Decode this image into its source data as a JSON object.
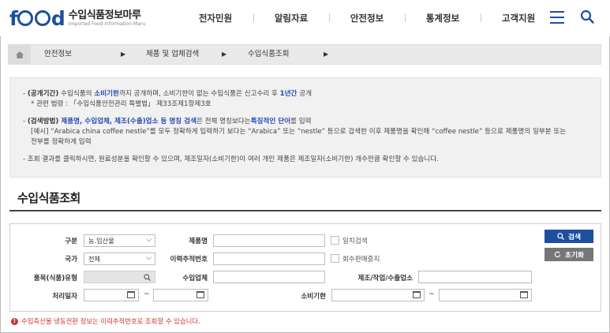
{
  "header": {
    "logo_title": "수입식품정보마루",
    "logo_sub": "Imported Food Information Maru",
    "nav": [
      "전자민원",
      "알림자료",
      "안전정보",
      "통계정보",
      "고객지원"
    ]
  },
  "breadcrumb": [
    "안전정보",
    "제품 및 업체검색",
    "수입식품조회"
  ],
  "notice": {
    "l1_a": "- ",
    "l1_b": "(공개기간)",
    "l1_c": " 수입식품의 ",
    "l1_d": "소비기한",
    "l1_e": "까지 공개하며, 소비기한이 없는 수입식품은 신고수리 후 ",
    "l1_f": "1년간",
    "l1_g": " 공개",
    "l2": "* 관련 법령 : 「수입식품안전관리 특별법」 제33조제1항제3호",
    "l3_a": "- ",
    "l3_b": "(검색방법)",
    "l3_c": " 제품명, 수입업체, 제조(수출)업소 등 명칭 검색",
    "l3_d": "은 전체 명칭보다는",
    "l3_e": "특징적인 단어",
    "l3_f": "를 입력",
    "l4": "[예시] “Arabica china coffee nestle”를 모두 정확하게 입력하기 보다는 “Arabica” 또는 “nestle” 등으로 검색한 이후 제품명을 확인해 “coffee nestle” 등으로 제품명의 일부분 또는",
    "l5": "전부를 정확하게 입력",
    "l6": "- 조회 결과를 클릭하시면, 원료성분을 확인할 수 있으며, 제조일자(소비기한)이 여러 개인 제품은 제조일자(소비기한) 개수만큼 확인할 수 있습니다."
  },
  "page_title": "수입식품조회",
  "form": {
    "category_label": "구분",
    "category_value": "농.임산물",
    "country_label": "국가",
    "country_value": "전체",
    "type_label": "품목(식품)유형",
    "date_label": "처리일자",
    "product_label": "제품명",
    "trace_label": "이력추적번호",
    "importer_label": "수입업체",
    "expiry_label": "소비기한",
    "exact_label": "일치검색",
    "recall_label": "회수판매중지",
    "maker_label": "제조/작업/수출업소",
    "tilde": "~",
    "search_button": "검색",
    "reset_button": "초기화"
  },
  "warning": "수입축산물 냉동전환 정보는 이력추적번호로 조회할 수 있습니다."
}
